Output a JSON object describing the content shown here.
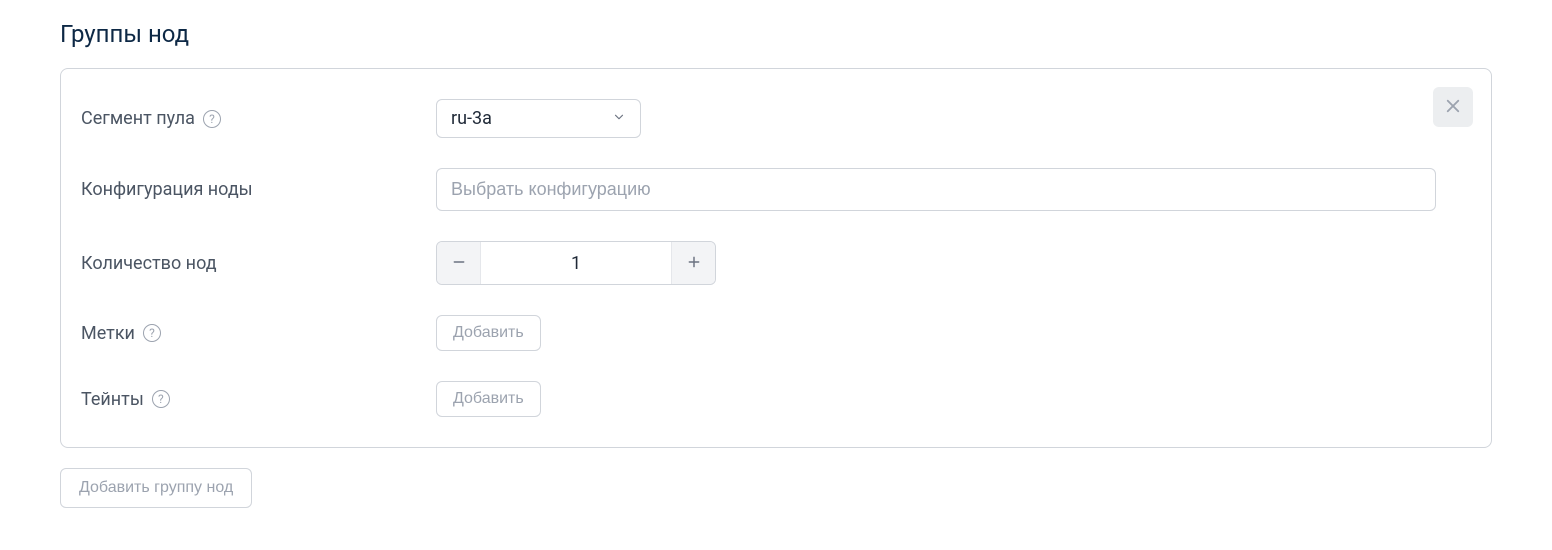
{
  "section": {
    "title": "Группы нод"
  },
  "group": {
    "pool_segment": {
      "label": "Сегмент пула",
      "value": "ru-3a"
    },
    "node_config": {
      "label": "Конфигурация ноды",
      "placeholder": "Выбрать конфигурацию"
    },
    "node_count": {
      "label": "Количество нод",
      "value": "1"
    },
    "labels": {
      "label": "Метки",
      "button": "Добавить"
    },
    "taints": {
      "label": "Тейнты",
      "button": "Добавить"
    }
  },
  "actions": {
    "add_group": "Добавить группу нод"
  }
}
